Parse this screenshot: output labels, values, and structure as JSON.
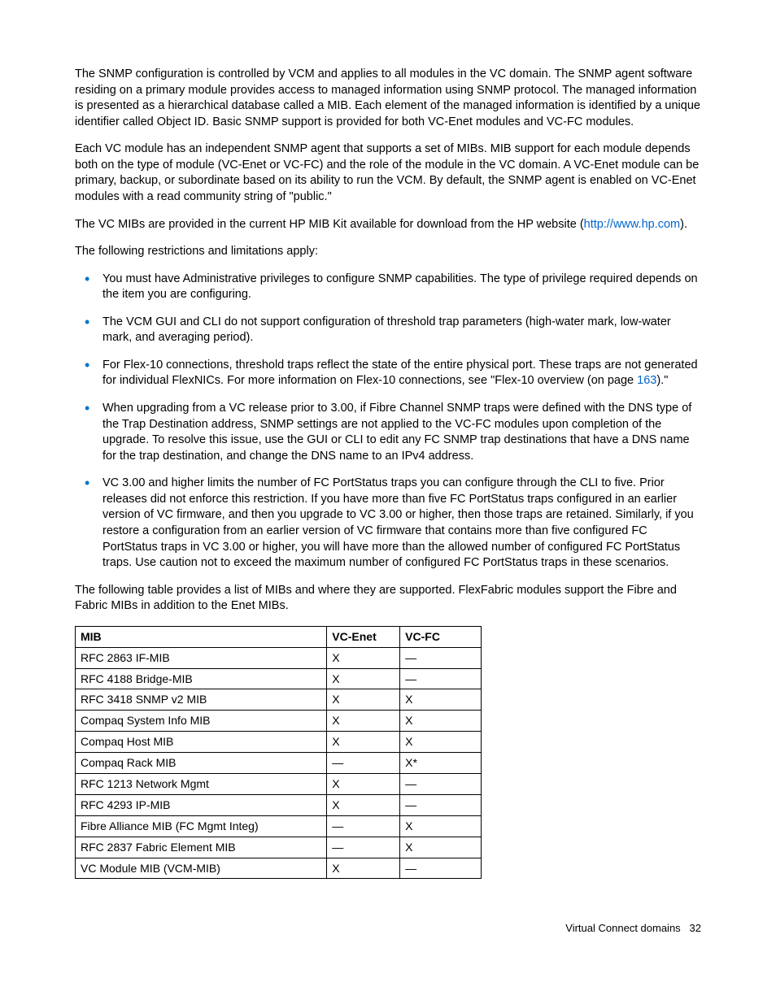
{
  "paragraphs": {
    "p1": "The SNMP configuration is controlled by VCM and applies to all modules in the VC domain. The SNMP agent software residing on a primary module provides access to managed information using SNMP protocol. The managed information is presented as a hierarchical database called a MIB. Each element of the managed information is identified by a unique identifier called Object ID. Basic SNMP support is provided for both VC-Enet modules and VC-FC modules.",
    "p2": "Each VC module has an independent SNMP agent that supports a set of MIBs. MIB support for each module depends both on the type of module (VC-Enet or VC-FC) and the role of the module in the VC domain. A VC-Enet module can be primary, backup, or subordinate based on its ability to run the VCM. By default, the SNMP agent is enabled on VC-Enet modules with a read community string of \"public.\"",
    "p3a": "The VC MIBs are provided in the current HP MIB Kit available for download from the HP website (",
    "p3link": "http://www.hp.com",
    "p3b": ").",
    "p4": "The following restrictions and limitations apply:",
    "p5": "The following table provides a list of MIBs and where they are supported. FlexFabric modules support the Fibre and Fabric MIBs in addition to the Enet MIBs."
  },
  "bullets": {
    "b1": "You must have Administrative privileges to configure SNMP capabilities. The type of privilege required depends on the item you are configuring.",
    "b2": "The VCM GUI and CLI do not support configuration of threshold trap parameters (high-water mark, low-water mark, and averaging period).",
    "b3a": "For Flex-10 connections, threshold traps reflect the state of the entire physical port. These traps are not generated for individual FlexNICs. For more information on Flex-10 connections, see \"Flex-10 overview (on page ",
    "b3link": "163",
    "b3b": ").\"",
    "b4": "When upgrading from a VC release prior to 3.00, if Fibre Channel SNMP traps were defined with the DNS type of the Trap Destination address, SNMP settings are not applied to the VC-FC modules upon completion of the upgrade. To resolve this issue, use the GUI or CLI to edit any FC SNMP trap destinations that have a DNS name for the trap destination, and change the DNS name to an IPv4 address.",
    "b5": "VC 3.00 and higher limits the number of FC PortStatus traps you can configure through the CLI to five. Prior releases did not enforce this restriction. If you have more than five FC PortStatus traps configured in an earlier version of VC firmware, and then you upgrade to VC 3.00 or higher, then those traps are retained. Similarly, if you restore a configuration from an earlier version of VC firmware that contains more than five configured FC PortStatus traps in VC 3.00 or higher, you will have more than the allowed number of configured FC PortStatus traps. Use caution not to exceed the maximum number of configured FC PortStatus traps in these scenarios."
  },
  "table": {
    "headers": {
      "h1": "MIB",
      "h2": "VC-Enet",
      "h3": "VC-FC"
    },
    "rows": [
      {
        "mib": "RFC 2863 IF-MIB",
        "enet": "X",
        "fc": "—"
      },
      {
        "mib": "RFC 4188 Bridge-MIB",
        "enet": "X",
        "fc": "—"
      },
      {
        "mib": "RFC 3418 SNMP v2 MIB",
        "enet": "X",
        "fc": "X"
      },
      {
        "mib": "Compaq System Info MIB",
        "enet": "X",
        "fc": "X"
      },
      {
        "mib": "Compaq Host MIB",
        "enet": "X",
        "fc": "X"
      },
      {
        "mib": "Compaq Rack MIB",
        "enet": "—",
        "fc": "X*"
      },
      {
        "mib": "RFC 1213 Network Mgmt",
        "enet": "X",
        "fc": "—"
      },
      {
        "mib": "RFC 4293 IP-MIB",
        "enet": "X",
        "fc": "—"
      },
      {
        "mib": "Fibre Alliance MIB (FC Mgmt Integ)",
        "enet": "—",
        "fc": "X"
      },
      {
        "mib": "RFC 2837 Fabric Element MIB",
        "enet": "—",
        "fc": "X"
      },
      {
        "mib": "VC Module MIB (VCM-MIB)",
        "enet": "X",
        "fc": "—"
      }
    ]
  },
  "footer": {
    "section": "Virtual Connect domains",
    "page": "32"
  }
}
